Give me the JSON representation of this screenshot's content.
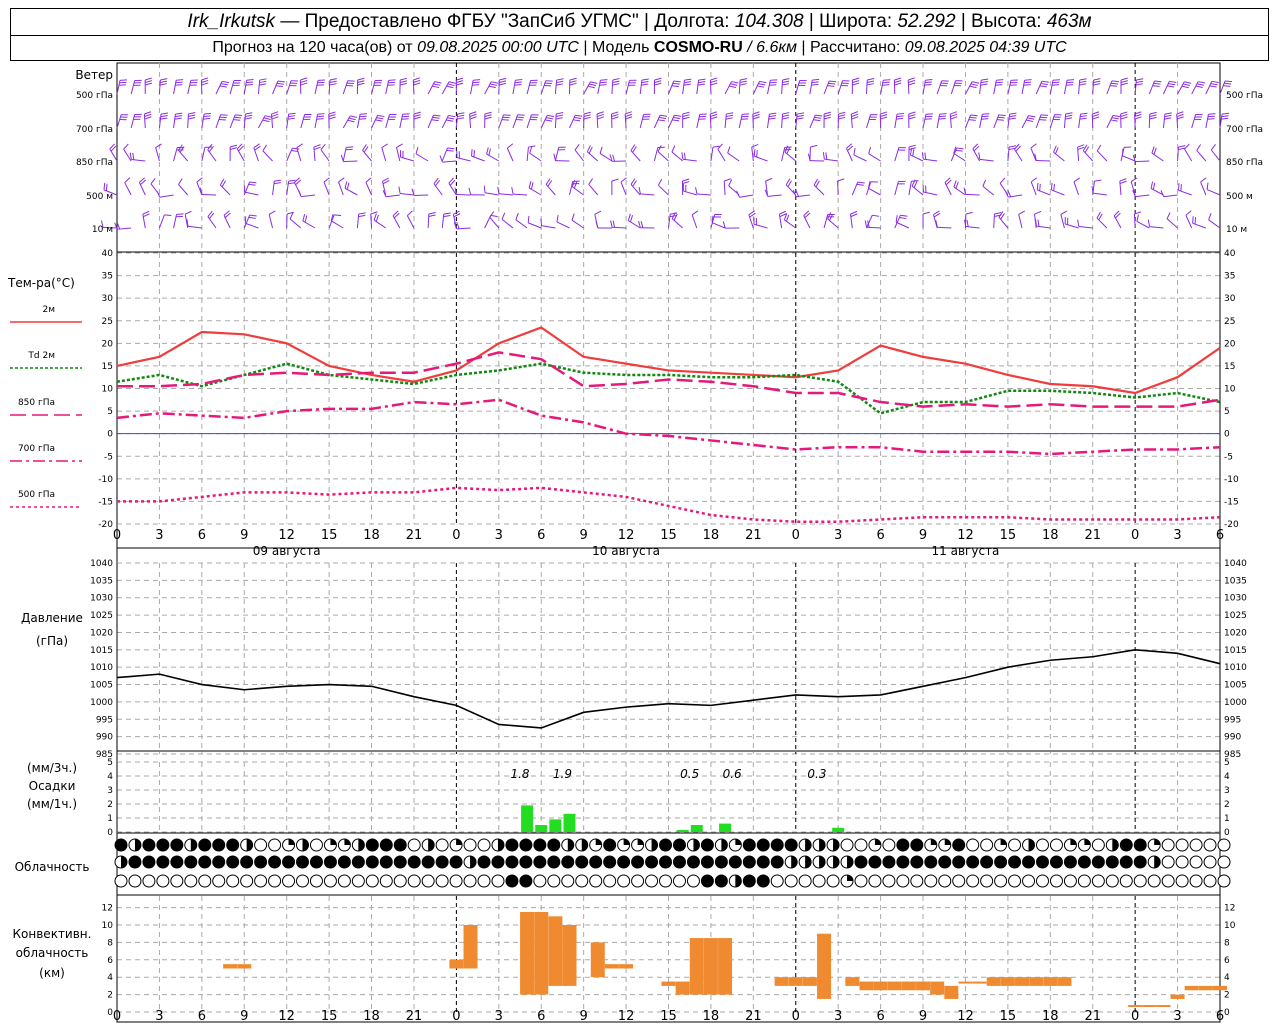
{
  "header": {
    "station": "Irk_Irkutsk",
    "provider": "— Предоставлено ФГБУ \"ЗапСиб УГМС\" |",
    "lon_label": "Долгота:",
    "lon": "104.308",
    "lat_label": "| Широта:",
    "lat": "52.292",
    "alt_label": "| Высота:",
    "alt": "463м",
    "forecast_prefix": "Прогноз на 120 часа(ов) от",
    "forecast_date": "09.08.2025 00:00 UTC",
    "model_label": "| Модель",
    "model": "COSMO-RU",
    "model_res": "/ 6.6км",
    "calc_label": "| Рассчитано:",
    "calc_date": "09.08.2025 04:39 UTC"
  },
  "colors": {
    "t2m": "#f03c3c",
    "td2m": "#118811",
    "t850": "#e6197a",
    "t700": "#e6197a",
    "t500": "#e6197a",
    "wind": "#8a2be2",
    "precip": "#22dd22",
    "convective": "#f08a30",
    "pressure": "#000000"
  },
  "time_axis": {
    "hour_ticks": [
      "0",
      "3",
      "6",
      "9",
      "12",
      "15",
      "18",
      "21",
      "0",
      "3",
      "6",
      "9",
      "12",
      "15",
      "18",
      "21",
      "0",
      "3",
      "6",
      "9",
      "12",
      "15",
      "18",
      "21",
      "0",
      "3",
      "6"
    ],
    "day_labels": [
      "09 августа",
      "10 августа",
      "11 августа"
    ]
  },
  "wind_panel": {
    "title": "Ветер",
    "levels": [
      "500 гПа",
      "700 гПа",
      "850 гПа",
      "500 м",
      "10 м"
    ]
  },
  "chart_data": [
    {
      "type": "line",
      "title": "Тем-ра(°C)",
      "ylim": [
        -20,
        40
      ],
      "x_hours": [
        0,
        3,
        6,
        9,
        12,
        15,
        18,
        21,
        24,
        27,
        30,
        33,
        36,
        39,
        42,
        45,
        48,
        51,
        54,
        57,
        60,
        63,
        66,
        69,
        72,
        75,
        78
      ],
      "series": [
        {
          "name": "2м",
          "values": [
            15,
            17,
            22.5,
            22,
            20,
            15,
            13,
            11.5,
            14,
            20,
            23.5,
            17,
            15.5,
            14,
            13.5,
            13,
            12.5,
            14,
            19.5,
            17,
            15.5,
            13,
            11,
            10.5,
            9,
            12.5,
            19
          ]
        },
        {
          "name": "Td 2м",
          "values": [
            11.5,
            13,
            10.5,
            13,
            15.5,
            13,
            12,
            11,
            13,
            14,
            15.5,
            13.5,
            13,
            13,
            12.5,
            12.5,
            13,
            11.5,
            4.5,
            7,
            7,
            9.5,
            9.5,
            9,
            8,
            9,
            7
          ]
        },
        {
          "name": "850 гПа",
          "values": [
            10.5,
            10.5,
            11,
            13,
            13.5,
            13,
            13.5,
            13.5,
            15.5,
            18,
            16.5,
            10.5,
            11,
            12,
            11.5,
            10.5,
            9,
            9,
            7,
            6,
            6.5,
            6,
            6.5,
            6,
            6,
            6,
            7.5
          ]
        },
        {
          "name": "700 гПа",
          "values": [
            3.5,
            4.5,
            4,
            3.5,
            5,
            5.5,
            5.5,
            7,
            6.5,
            7.5,
            4,
            2.5,
            0,
            -0.5,
            -1.5,
            -2.5,
            -3.5,
            -3,
            -3,
            -4,
            -4,
            -4,
            -4.5,
            -4,
            -3.5,
            -3.5,
            -3
          ]
        },
        {
          "name": "500 гПа",
          "values": [
            -15,
            -15,
            -14,
            -13,
            -13,
            -13.5,
            -13,
            -13,
            -12,
            -12.5,
            -12,
            -13,
            -14,
            -16,
            -18,
            -19,
            -19.5,
            -19.5,
            -19,
            -18.5,
            -18.5,
            -18.5,
            -19,
            -19,
            -19,
            -19,
            -18.5
          ]
        }
      ]
    },
    {
      "type": "line",
      "title": "Давление",
      "unit": "(гПа)",
      "ylim": [
        985,
        1040
      ],
      "x_hours": [
        0,
        3,
        6,
        9,
        12,
        15,
        18,
        21,
        24,
        27,
        30,
        33,
        36,
        39,
        42,
        45,
        48,
        51,
        54,
        57,
        60,
        63,
        66,
        69,
        72,
        75,
        78
      ],
      "values": [
        1007,
        1008,
        1005,
        1003.5,
        1004.5,
        1005,
        1004.5,
        1001.5,
        999,
        993.5,
        992.5,
        997,
        998.5,
        999.5,
        999,
        1000.5,
        1002,
        1001.5,
        1002,
        1004.5,
        1007,
        1010,
        1012,
        1013,
        1015,
        1014,
        1011
      ]
    },
    {
      "type": "bar",
      "title": "Осадки",
      "unit_top": "(мм/3ч.)",
      "unit_bottom": "(мм/1ч.)",
      "ylim": [
        0,
        5
      ],
      "bars_hours": [
        29,
        30,
        31,
        32,
        40,
        41,
        43,
        51
      ],
      "bars_values": [
        1.9,
        0.5,
        0.9,
        1.3,
        0.15,
        0.5,
        0.6,
        0.3
      ],
      "annotations": [
        {
          "hour": 28.5,
          "text": "1.8"
        },
        {
          "hour": 31.5,
          "text": "1.9"
        },
        {
          "hour": 40.5,
          "text": "0.5"
        },
        {
          "hour": 43.5,
          "text": "0.6"
        },
        {
          "hour": 49.5,
          "text": "0.3"
        }
      ]
    },
    {
      "type": "bar",
      "title": "Облачность",
      "rows": 3,
      "values_row1": [
        8,
        5,
        8,
        8,
        8,
        5,
        8,
        8,
        8,
        5,
        0,
        0,
        3,
        5,
        0,
        3,
        3,
        5,
        8,
        8,
        8,
        0,
        5,
        0,
        3,
        0,
        0,
        5,
        8,
        8,
        8,
        8,
        5,
        5,
        3,
        8,
        3,
        3,
        5,
        8,
        8,
        5,
        8,
        5,
        3,
        8,
        8,
        8,
        8,
        5,
        5,
        5,
        0,
        0,
        3,
        0,
        8,
        8,
        3,
        3,
        8,
        0,
        0,
        3,
        0,
        5,
        0,
        0,
        3,
        3,
        0,
        5,
        8,
        8,
        3,
        0,
        0,
        0,
        0,
        0
      ],
      "values_row2": [
        5,
        8,
        8,
        8,
        8,
        8,
        8,
        8,
        8,
        8,
        8,
        8,
        8,
        8,
        8,
        8,
        8,
        8,
        8,
        8,
        8,
        8,
        8,
        8,
        8,
        5,
        8,
        8,
        8,
        8,
        8,
        8,
        8,
        8,
        8,
        8,
        8,
        8,
        8,
        8,
        8,
        8,
        8,
        8,
        8,
        8,
        8,
        8,
        5,
        5,
        5,
        5,
        5,
        8,
        8,
        8,
        8,
        8,
        8,
        8,
        8,
        8,
        8,
        8,
        8,
        8,
        8,
        8,
        8,
        8,
        8,
        8,
        8,
        8,
        5,
        0,
        0,
        0,
        0,
        0
      ],
      "values_row3": [
        0,
        0,
        0,
        0,
        0,
        0,
        0,
        0,
        0,
        0,
        0,
        0,
        0,
        0,
        0,
        0,
        0,
        0,
        0,
        0,
        0,
        0,
        0,
        0,
        0,
        0,
        0,
        0,
        8,
        8,
        0,
        0,
        0,
        0,
        0,
        0,
        0,
        0,
        0,
        0,
        0,
        0,
        8,
        8,
        5,
        8,
        8,
        0,
        0,
        0,
        0,
        0,
        3,
        0,
        0,
        0,
        0,
        0,
        0,
        0,
        0,
        0,
        0,
        0,
        0,
        0,
        0,
        0,
        0,
        0,
        0,
        0,
        0,
        0,
        0,
        0,
        0,
        0,
        0,
        0
      ]
    },
    {
      "type": "bar",
      "title": "Конвективн. облачность",
      "unit": "(км)",
      "ylim": [
        0,
        12
      ],
      "hours": [
        8,
        9,
        24,
        25,
        29,
        30,
        31,
        32,
        34,
        35,
        36,
        39,
        40,
        41,
        42,
        43,
        47,
        48,
        49,
        50,
        52,
        53,
        54,
        55,
        56,
        57,
        58,
        59,
        60,
        61,
        62,
        63,
        64,
        65,
        66,
        67,
        72,
        73,
        74,
        75,
        76,
        77,
        78
      ],
      "bottoms": [
        5,
        5,
        5,
        5,
        2,
        2,
        3,
        3,
        4,
        5,
        5,
        3,
        2,
        2,
        2,
        2,
        3,
        3,
        3,
        1.5,
        3,
        2.5,
        2.5,
        2.5,
        2.5,
        2.5,
        2,
        1.5,
        3.5,
        3.5,
        3,
        3,
        3,
        3,
        3,
        3,
        0.6,
        0.6,
        0.6,
        1.5,
        2.5,
        2.5,
        2.5
      ],
      "tops": [
        5.5,
        5.5,
        6,
        10,
        11.5,
        11.5,
        11,
        10,
        8,
        5.5,
        5.5,
        3.5,
        3.5,
        8.5,
        8.5,
        8.5,
        4,
        4,
        4,
        9,
        4,
        3.5,
        3.5,
        3.5,
        3.5,
        3.5,
        3.5,
        3,
        3.5,
        3.5,
        4,
        4,
        4,
        4,
        4,
        4,
        0.8,
        0.8,
        0.8,
        2,
        3,
        3,
        3
      ]
    }
  ]
}
